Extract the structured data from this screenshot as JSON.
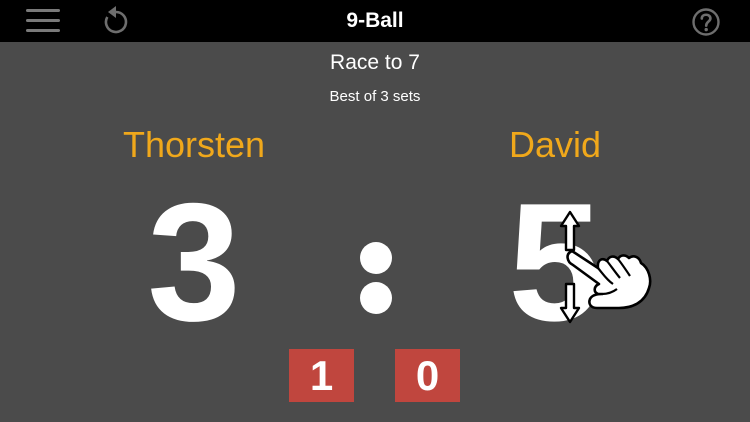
{
  "header": {
    "title": "9-Ball",
    "menu_icon": "hamburger-menu-icon",
    "undo_icon": "undo-icon",
    "help_icon": "help-icon"
  },
  "match": {
    "race": "Race to 7",
    "sets_format": "Best of 3 sets"
  },
  "players": [
    {
      "name": "Thorsten",
      "score": "3",
      "sets": "1"
    },
    {
      "name": "David",
      "score": "5",
      "sets": "0"
    }
  ],
  "colors": {
    "background": "#4b4b4b",
    "topbar": "#000000",
    "player_name": "#f0a81b",
    "set_box": "#c0463e"
  },
  "hint": {
    "icon": "swipe-up-down-gesture-icon"
  }
}
